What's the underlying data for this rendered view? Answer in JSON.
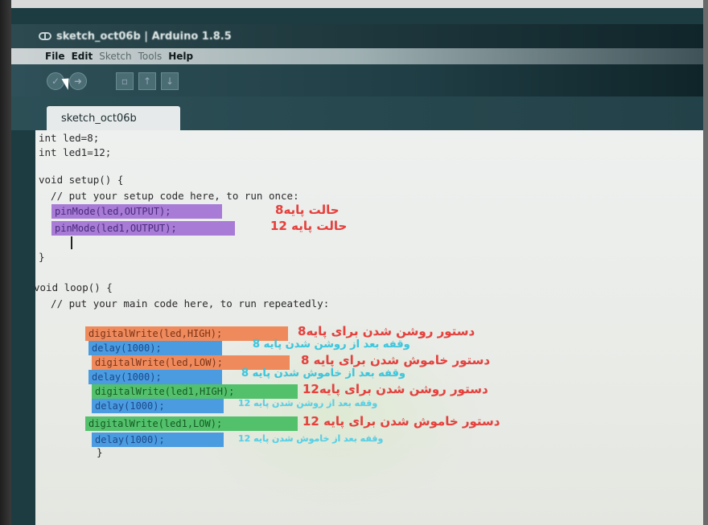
{
  "window": {
    "title": "sketch_oct06b | Arduino 1.8.5"
  },
  "menu": {
    "items": [
      "File",
      "Edit",
      "Sketch",
      "Tools",
      "Help"
    ]
  },
  "toolbar": {
    "icons": [
      "verify-icon",
      "upload-icon",
      "new-icon",
      "open-icon",
      "save-icon"
    ]
  },
  "tabs": [
    {
      "label": "sketch_oct06b"
    }
  ],
  "code": {
    "line1": "int led=8;",
    "line2": "int led1=12;",
    "setup_sig": "void setup() {",
    "setup_comment": "  // put your setup code here, to run once:",
    "pinmode1": "pinMode(led,OUTPUT);",
    "pinmode2": "pinMode(led1,OUTPUT);",
    "close1": "}",
    "loop_sig": "void loop() {",
    "loop_comment": "  // put your main code here, to run repeatedly:",
    "dw1": "digitalWrite(led,HIGH);",
    "delay1": "delay(1000);",
    "dw2": "digitalWrite(led,LOW);",
    "delay2": "delay(1000);",
    "dw3": "digitalWrite(led1,HIGH);",
    "delay3": "delay(1000);",
    "dw4": "digitalWrite(led1,LOW);",
    "delay4": "delay(1000);",
    "close2": "}"
  },
  "annotations": {
    "pin8_mode": "حالت پایه8",
    "pin12_mode": "حالت پایه 12",
    "on8": "دستور روشن شدن برای پایه8",
    "after_on8": "وقفه بعد از روشن شدن پایه 8",
    "off8": "دستور خاموش شدن برای پایه 8",
    "after_off8": "وقفه بعد از خاموش شدن پایه 8",
    "on12": "دستور روشن شدن برای پایه12",
    "after_on12": "وقفه بعد از روشن شدن پایه 12",
    "off12": "دستور خاموش شدن برای پایه 12",
    "after_off12": "وقفه بعد از خاموش شدن پایه 12"
  },
  "colors": {
    "purple": "#a77bd6",
    "orange": "#ef8a5c",
    "blue": "#4b9be0",
    "green": "#53c16c",
    "annotation_red": "#e8403c",
    "annotation_cyan": "#39c8e0"
  }
}
